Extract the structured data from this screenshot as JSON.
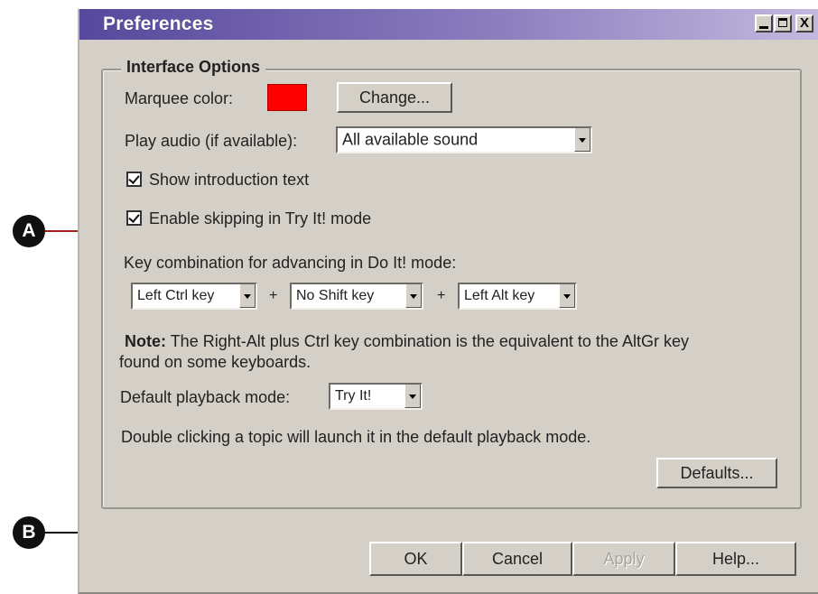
{
  "window": {
    "title": "Preferences"
  },
  "title_buttons": {
    "close_glyph": "X"
  },
  "group": {
    "legend": "Interface Options"
  },
  "marquee": {
    "label": "Marquee color:",
    "swatch_color": "#ff0000",
    "change_button": "Change..."
  },
  "audio": {
    "label": "Play audio (if available):",
    "value": "All available sound"
  },
  "checkboxes": {
    "intro": {
      "label": "Show introduction text",
      "checked": true
    },
    "skipping": {
      "label": "Enable skipping in Try It! mode",
      "checked": true
    }
  },
  "keycombo": {
    "label": "Key combination for advancing in Do It! mode:",
    "ctrl": "Left Ctrl key",
    "shift": "No Shift key",
    "alt": "Left Alt key",
    "plus": "+"
  },
  "note": {
    "bold": "Note:",
    "line1": "The Right-Alt plus Ctrl key combination is the equivalent to the AltGr key",
    "line2": "found on some keyboards."
  },
  "playback": {
    "label": "Default playback mode:",
    "value": "Try It!",
    "hint": "Double clicking a topic will launch it in the default playback mode."
  },
  "buttons": {
    "defaults": "Defaults...",
    "ok": "OK",
    "cancel": "Cancel",
    "apply": "Apply",
    "help": "Help..."
  },
  "callouts": {
    "a": "A",
    "b": "B"
  },
  "colors": {
    "brace_color": "#a32020",
    "titlebar_start": "#56489c",
    "window_bg": "#d4d0c8"
  }
}
